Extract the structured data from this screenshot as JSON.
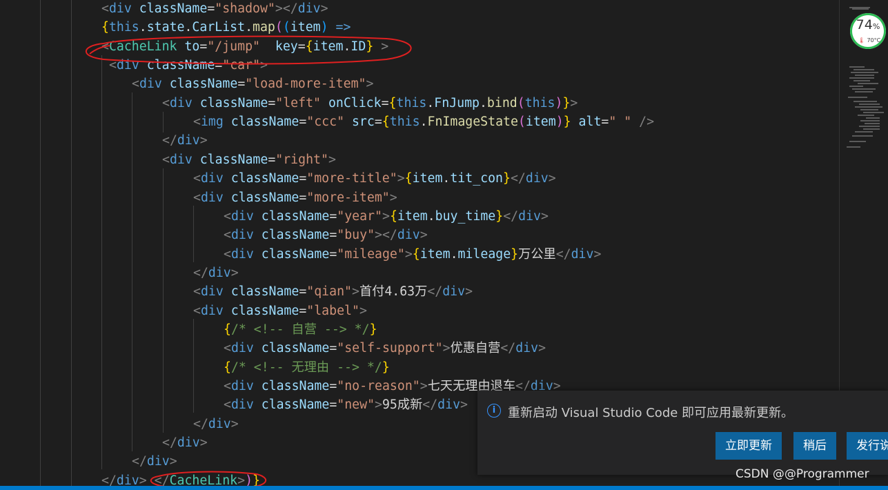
{
  "editor": {
    "lines": [
      {
        "indent": 147,
        "tokens": [
          {
            "c": "p",
            "t": "<"
          },
          {
            "c": "t",
            "t": "div"
          },
          {
            "c": "tx",
            "t": " "
          },
          {
            "c": "a",
            "t": "className"
          },
          {
            "c": "tx",
            "t": "="
          },
          {
            "c": "s",
            "t": "\"shadow\""
          },
          {
            "c": "p",
            "t": "></"
          },
          {
            "c": "t",
            "t": "div"
          },
          {
            "c": "p",
            "t": ">"
          }
        ]
      },
      {
        "indent": 147,
        "tokens": [
          {
            "c": "br",
            "t": "{"
          },
          {
            "c": "k",
            "t": "this"
          },
          {
            "c": "tx",
            "t": "."
          },
          {
            "c": "a",
            "t": "state"
          },
          {
            "c": "tx",
            "t": "."
          },
          {
            "c": "a",
            "t": "CarList"
          },
          {
            "c": "tx",
            "t": "."
          },
          {
            "c": "f",
            "t": "map"
          },
          {
            "c": "br2",
            "t": "("
          },
          {
            "c": "br3",
            "t": "("
          },
          {
            "c": "a",
            "t": "item"
          },
          {
            "c": "br3",
            "t": ")"
          },
          {
            "c": "tx",
            "t": " "
          },
          {
            "c": "k",
            "t": "=>"
          }
        ]
      },
      {
        "indent": 147,
        "tokens": [
          {
            "c": "p",
            "t": "<"
          },
          {
            "c": "comp",
            "t": "CacheLink"
          },
          {
            "c": "tx",
            "t": " "
          },
          {
            "c": "a",
            "t": "to"
          },
          {
            "c": "tx",
            "t": "="
          },
          {
            "c": "s",
            "t": "\"/jump\""
          },
          {
            "c": "tx",
            "t": "  "
          },
          {
            "c": "a",
            "t": "key"
          },
          {
            "c": "tx",
            "t": "="
          },
          {
            "c": "br",
            "t": "{"
          },
          {
            "c": "a",
            "t": "item"
          },
          {
            "c": "tx",
            "t": "."
          },
          {
            "c": "a",
            "t": "ID"
          },
          {
            "c": "br",
            "t": "}"
          },
          {
            "c": "tx",
            "t": " "
          },
          {
            "c": "p",
            "t": ">"
          }
        ]
      },
      {
        "indent": 158,
        "tokens": [
          {
            "c": "p",
            "t": "<"
          },
          {
            "c": "t",
            "t": "div"
          },
          {
            "c": "tx",
            "t": " "
          },
          {
            "c": "a",
            "t": "className"
          },
          {
            "c": "tx",
            "t": "="
          },
          {
            "c": "s",
            "t": "\"car\""
          },
          {
            "c": "p",
            "t": ">"
          }
        ]
      },
      {
        "indent": 191,
        "tokens": [
          {
            "c": "p",
            "t": "<"
          },
          {
            "c": "t",
            "t": "div"
          },
          {
            "c": "tx",
            "t": " "
          },
          {
            "c": "a",
            "t": "className"
          },
          {
            "c": "tx",
            "t": "="
          },
          {
            "c": "s",
            "t": "\"load-more-item\""
          },
          {
            "c": "p",
            "t": ">"
          }
        ]
      },
      {
        "indent": 235,
        "tokens": [
          {
            "c": "p",
            "t": "<"
          },
          {
            "c": "t",
            "t": "div"
          },
          {
            "c": "tx",
            "t": " "
          },
          {
            "c": "a",
            "t": "className"
          },
          {
            "c": "tx",
            "t": "="
          },
          {
            "c": "s",
            "t": "\"left\""
          },
          {
            "c": "tx",
            "t": " "
          },
          {
            "c": "a",
            "t": "onClick"
          },
          {
            "c": "tx",
            "t": "="
          },
          {
            "c": "br",
            "t": "{"
          },
          {
            "c": "k",
            "t": "this"
          },
          {
            "c": "tx",
            "t": "."
          },
          {
            "c": "a",
            "t": "FnJump"
          },
          {
            "c": "tx",
            "t": "."
          },
          {
            "c": "f",
            "t": "bind"
          },
          {
            "c": "br2",
            "t": "("
          },
          {
            "c": "k",
            "t": "this"
          },
          {
            "c": "br2",
            "t": ")"
          },
          {
            "c": "br",
            "t": "}"
          },
          {
            "c": "p",
            "t": ">"
          }
        ]
      },
      {
        "indent": 280,
        "tokens": [
          {
            "c": "p",
            "t": "<"
          },
          {
            "c": "t",
            "t": "img"
          },
          {
            "c": "tx",
            "t": " "
          },
          {
            "c": "a",
            "t": "className"
          },
          {
            "c": "tx",
            "t": "="
          },
          {
            "c": "s",
            "t": "\"ccc\""
          },
          {
            "c": "tx",
            "t": " "
          },
          {
            "c": "a",
            "t": "src"
          },
          {
            "c": "tx",
            "t": "="
          },
          {
            "c": "br",
            "t": "{"
          },
          {
            "c": "k",
            "t": "this"
          },
          {
            "c": "tx",
            "t": "."
          },
          {
            "c": "f",
            "t": "FnImageState"
          },
          {
            "c": "br2",
            "t": "("
          },
          {
            "c": "a",
            "t": "item"
          },
          {
            "c": "br2",
            "t": ")"
          },
          {
            "c": "br",
            "t": "}"
          },
          {
            "c": "tx",
            "t": " "
          },
          {
            "c": "a",
            "t": "alt"
          },
          {
            "c": "tx",
            "t": "="
          },
          {
            "c": "s",
            "t": "\" \""
          },
          {
            "c": "tx",
            "t": " "
          },
          {
            "c": "p",
            "t": "/>"
          }
        ]
      },
      {
        "indent": 235,
        "tokens": [
          {
            "c": "p",
            "t": "</"
          },
          {
            "c": "t",
            "t": "div"
          },
          {
            "c": "p",
            "t": ">"
          }
        ]
      },
      {
        "indent": 235,
        "tokens": [
          {
            "c": "p",
            "t": "<"
          },
          {
            "c": "t",
            "t": "div"
          },
          {
            "c": "tx",
            "t": " "
          },
          {
            "c": "a",
            "t": "className"
          },
          {
            "c": "tx",
            "t": "="
          },
          {
            "c": "s",
            "t": "\"right\""
          },
          {
            "c": "p",
            "t": ">"
          }
        ]
      },
      {
        "indent": 280,
        "tokens": [
          {
            "c": "p",
            "t": "<"
          },
          {
            "c": "t",
            "t": "div"
          },
          {
            "c": "tx",
            "t": " "
          },
          {
            "c": "a",
            "t": "className"
          },
          {
            "c": "tx",
            "t": "="
          },
          {
            "c": "s",
            "t": "\"more-title\""
          },
          {
            "c": "p",
            "t": ">"
          },
          {
            "c": "br",
            "t": "{"
          },
          {
            "c": "a",
            "t": "item"
          },
          {
            "c": "tx",
            "t": "."
          },
          {
            "c": "a",
            "t": "tit_con"
          },
          {
            "c": "br",
            "t": "}"
          },
          {
            "c": "p",
            "t": "</"
          },
          {
            "c": "t",
            "t": "div"
          },
          {
            "c": "p",
            "t": ">"
          }
        ]
      },
      {
        "indent": 280,
        "tokens": [
          {
            "c": "p",
            "t": "<"
          },
          {
            "c": "t",
            "t": "div"
          },
          {
            "c": "tx",
            "t": " "
          },
          {
            "c": "a",
            "t": "className"
          },
          {
            "c": "tx",
            "t": "="
          },
          {
            "c": "s",
            "t": "\"more-item\""
          },
          {
            "c": "p",
            "t": ">"
          }
        ]
      },
      {
        "indent": 324,
        "tokens": [
          {
            "c": "p",
            "t": "<"
          },
          {
            "c": "t",
            "t": "div"
          },
          {
            "c": "tx",
            "t": " "
          },
          {
            "c": "a",
            "t": "className"
          },
          {
            "c": "tx",
            "t": "="
          },
          {
            "c": "s",
            "t": "\"year\""
          },
          {
            "c": "p",
            "t": ">"
          },
          {
            "c": "br",
            "t": "{"
          },
          {
            "c": "a",
            "t": "item"
          },
          {
            "c": "tx",
            "t": "."
          },
          {
            "c": "a",
            "t": "buy_time"
          },
          {
            "c": "br",
            "t": "}"
          },
          {
            "c": "p",
            "t": "</"
          },
          {
            "c": "t",
            "t": "div"
          },
          {
            "c": "p",
            "t": ">"
          }
        ]
      },
      {
        "indent": 324,
        "tokens": [
          {
            "c": "p",
            "t": "<"
          },
          {
            "c": "t",
            "t": "div"
          },
          {
            "c": "tx",
            "t": " "
          },
          {
            "c": "a",
            "t": "className"
          },
          {
            "c": "tx",
            "t": "="
          },
          {
            "c": "s",
            "t": "\"buy\""
          },
          {
            "c": "p",
            "t": "></"
          },
          {
            "c": "t",
            "t": "div"
          },
          {
            "c": "p",
            "t": ">"
          }
        ]
      },
      {
        "indent": 324,
        "tokens": [
          {
            "c": "p",
            "t": "<"
          },
          {
            "c": "t",
            "t": "div"
          },
          {
            "c": "tx",
            "t": " "
          },
          {
            "c": "a",
            "t": "className"
          },
          {
            "c": "tx",
            "t": "="
          },
          {
            "c": "s",
            "t": "\"mileage\""
          },
          {
            "c": "p",
            "t": ">"
          },
          {
            "c": "br",
            "t": "{"
          },
          {
            "c": "a",
            "t": "item"
          },
          {
            "c": "tx",
            "t": "."
          },
          {
            "c": "a",
            "t": "mileage"
          },
          {
            "c": "br",
            "t": "}"
          },
          {
            "c": "tx",
            "t": "万公里"
          },
          {
            "c": "p",
            "t": "</"
          },
          {
            "c": "t",
            "t": "div"
          },
          {
            "c": "p",
            "t": ">"
          }
        ]
      },
      {
        "indent": 280,
        "tokens": [
          {
            "c": "p",
            "t": "</"
          },
          {
            "c": "t",
            "t": "div"
          },
          {
            "c": "p",
            "t": ">"
          }
        ]
      },
      {
        "indent": 280,
        "tokens": [
          {
            "c": "p",
            "t": "<"
          },
          {
            "c": "t",
            "t": "div"
          },
          {
            "c": "tx",
            "t": " "
          },
          {
            "c": "a",
            "t": "className"
          },
          {
            "c": "tx",
            "t": "="
          },
          {
            "c": "s",
            "t": "\"qian\""
          },
          {
            "c": "p",
            "t": ">"
          },
          {
            "c": "tx",
            "t": "首付4.63万"
          },
          {
            "c": "p",
            "t": "</"
          },
          {
            "c": "t",
            "t": "div"
          },
          {
            "c": "p",
            "t": ">"
          }
        ]
      },
      {
        "indent": 280,
        "tokens": [
          {
            "c": "p",
            "t": "<"
          },
          {
            "c": "t",
            "t": "div"
          },
          {
            "c": "tx",
            "t": " "
          },
          {
            "c": "a",
            "t": "className"
          },
          {
            "c": "tx",
            "t": "="
          },
          {
            "c": "s",
            "t": "\"label\""
          },
          {
            "c": "p",
            "t": ">"
          }
        ]
      },
      {
        "indent": 324,
        "tokens": [
          {
            "c": "br",
            "t": "{"
          },
          {
            "c": "c",
            "t": "/* <!-- 自营 --> */"
          },
          {
            "c": "br",
            "t": "}"
          }
        ]
      },
      {
        "indent": 324,
        "tokens": [
          {
            "c": "p",
            "t": "<"
          },
          {
            "c": "t",
            "t": "div"
          },
          {
            "c": "tx",
            "t": " "
          },
          {
            "c": "a",
            "t": "className"
          },
          {
            "c": "tx",
            "t": "="
          },
          {
            "c": "s",
            "t": "\"self-support\""
          },
          {
            "c": "p",
            "t": ">"
          },
          {
            "c": "tx",
            "t": "优惠自营"
          },
          {
            "c": "p",
            "t": "</"
          },
          {
            "c": "t",
            "t": "div"
          },
          {
            "c": "p",
            "t": ">"
          }
        ]
      },
      {
        "indent": 324,
        "tokens": [
          {
            "c": "br",
            "t": "{"
          },
          {
            "c": "c",
            "t": "/* <!-- 无理由 --> */"
          },
          {
            "c": "br",
            "t": "}"
          }
        ]
      },
      {
        "indent": 324,
        "tokens": [
          {
            "c": "p",
            "t": "<"
          },
          {
            "c": "t",
            "t": "div"
          },
          {
            "c": "tx",
            "t": " "
          },
          {
            "c": "a",
            "t": "className"
          },
          {
            "c": "tx",
            "t": "="
          },
          {
            "c": "s",
            "t": "\"no-reason\""
          },
          {
            "c": "p",
            "t": ">"
          },
          {
            "c": "tx",
            "t": "七天无理由退车"
          },
          {
            "c": "p",
            "t": "</"
          },
          {
            "c": "t",
            "t": "div"
          },
          {
            "c": "p",
            "t": ">"
          }
        ]
      },
      {
        "indent": 324,
        "tokens": [
          {
            "c": "p",
            "t": "<"
          },
          {
            "c": "t",
            "t": "div"
          },
          {
            "c": "tx",
            "t": " "
          },
          {
            "c": "a",
            "t": "className"
          },
          {
            "c": "tx",
            "t": "="
          },
          {
            "c": "s",
            "t": "\"new\""
          },
          {
            "c": "p",
            "t": ">"
          },
          {
            "c": "tx",
            "t": "95成新"
          },
          {
            "c": "p",
            "t": "</"
          },
          {
            "c": "t",
            "t": "div"
          },
          {
            "c": "p",
            "t": ">"
          }
        ]
      },
      {
        "indent": 280,
        "tokens": [
          {
            "c": "p",
            "t": "</"
          },
          {
            "c": "t",
            "t": "div"
          },
          {
            "c": "p",
            "t": ">"
          }
        ]
      },
      {
        "indent": 235,
        "tokens": [
          {
            "c": "p",
            "t": "</"
          },
          {
            "c": "t",
            "t": "div"
          },
          {
            "c": "p",
            "t": ">"
          }
        ]
      },
      {
        "indent": 191,
        "tokens": [
          {
            "c": "p",
            "t": "</"
          },
          {
            "c": "t",
            "t": "div"
          },
          {
            "c": "p",
            "t": ">"
          }
        ]
      },
      {
        "indent": 147,
        "tokens": [
          {
            "c": "p",
            "t": "</"
          },
          {
            "c": "t",
            "t": "div"
          },
          {
            "c": "p",
            "t": ">"
          },
          {
            "c": "tx",
            "t": " "
          },
          {
            "c": "p",
            "t": "</"
          },
          {
            "c": "comp",
            "t": "CacheLink"
          },
          {
            "c": "p",
            "t": ">"
          },
          {
            "c": "br2",
            "t": ")"
          },
          {
            "c": "br",
            "t": "}"
          }
        ]
      }
    ]
  },
  "gauge": {
    "percent": "74",
    "percent_sign": "%",
    "temperature": "70°C"
  },
  "notification": {
    "message": "重新启动 Visual Studio Code 即可应用最新更新。",
    "buttons": [
      {
        "label": "立即更新"
      },
      {
        "label": "稍后"
      },
      {
        "label": "发行说明"
      }
    ]
  },
  "watermark": "CSDN @@Programmer",
  "colors": {
    "editor_bg": "#1e1e1e",
    "tag": "#569cd6",
    "attribute": "#9cdcfe",
    "string": "#ce9178",
    "function": "#dcdcaa",
    "comment": "#6a9955",
    "component": "#4ec9b0",
    "annotation": "#e02020",
    "button": "#0e639c",
    "statusbar": "#007acc"
  }
}
